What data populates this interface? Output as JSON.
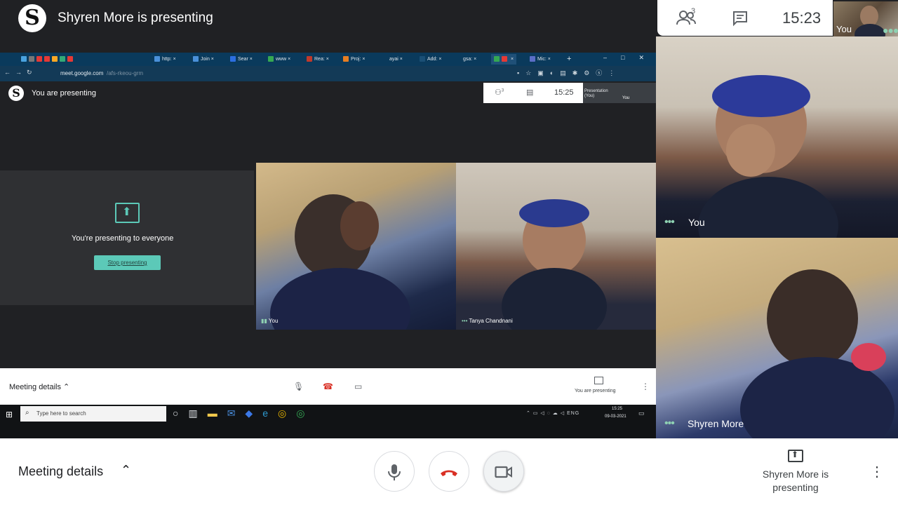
{
  "top": {
    "presenting_title": "Shyren More is presenting",
    "people_count": "3",
    "clock": "15:23",
    "self_label": "You"
  },
  "shared_screen": {
    "tabs": [
      "http:",
      "Join",
      "Sear",
      "www",
      "Rea:",
      "Proj:",
      "ayai",
      "Add:",
      "gsa:",
      "Mic:"
    ],
    "url": "meet.google.com",
    "url_suffix": "/afs-rkeou-grm",
    "inner_title": "You are presenting",
    "inner_people_count": "3",
    "inner_clock": "15:25",
    "inner_thumb_label": "Presentation (You)",
    "inner_thumb_you": "You",
    "present_message": "You're presenting to everyone",
    "stop_label": "Stop presenting",
    "tile_you": "You",
    "tile_tanya": "Tanya Chandnani",
    "meeting_details": "Meeting details",
    "you_are_presenting": "You are presenting",
    "search_placeholder": "Type here to search",
    "tray_time": "15:25",
    "tray_date": "09-03-2021",
    "tray_lang": "ENG"
  },
  "participants": [
    {
      "label": "You"
    },
    {
      "label": "Shyren More"
    }
  ],
  "bottom": {
    "meeting_details": "Meeting details",
    "presenting_status": "Shyren More is presenting"
  },
  "colors": {
    "accent": "#5cc9b8",
    "hangup": "#d93025",
    "dots": "#8ed1b2"
  },
  "icons": [
    "people-icon",
    "chat-icon",
    "mic-icon",
    "hangup-icon",
    "camera-icon",
    "present-icon",
    "more-icon",
    "chevron-up-icon"
  ]
}
